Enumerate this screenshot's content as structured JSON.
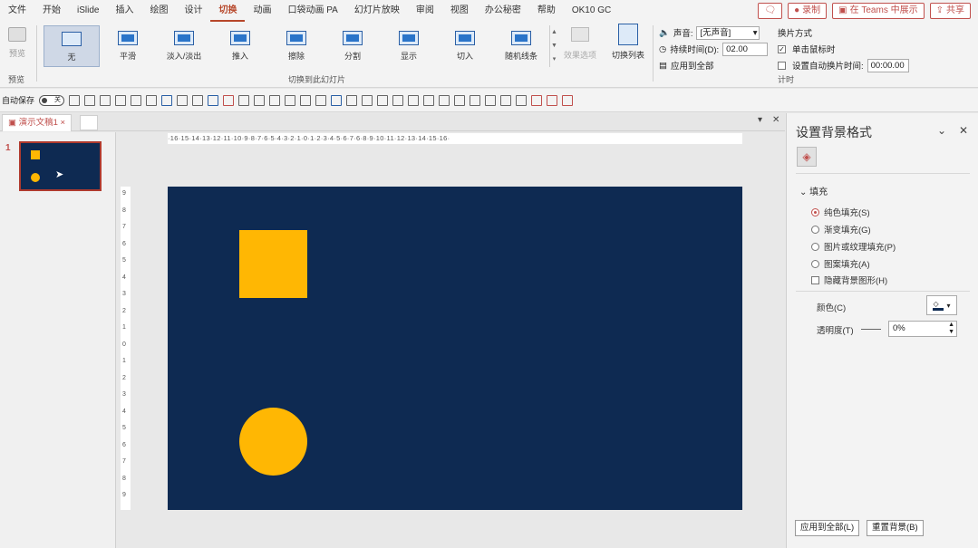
{
  "menu": {
    "tabs": [
      "文件",
      "开始",
      "iSlide",
      "插入",
      "绘图",
      "设计",
      "切换",
      "动画",
      "口袋动画 PA",
      "幻灯片放映",
      "审阅",
      "视图",
      "办公秘密",
      "帮助",
      "OK10 GC"
    ],
    "active_index": 6,
    "comment_label": "🗨",
    "record_label": "录制",
    "teams_label": "在 Teams 中展示",
    "share_label": "共享"
  },
  "ribbon": {
    "preview": {
      "label": "预览",
      "group_label": "预览"
    },
    "transitions": [
      {
        "label": "无",
        "active": true
      },
      {
        "label": "平滑"
      },
      {
        "label": "淡入/淡出"
      },
      {
        "label": "推入"
      },
      {
        "label": "擦除"
      },
      {
        "label": "分割"
      },
      {
        "label": "显示"
      },
      {
        "label": "切入"
      },
      {
        "label": "随机线条"
      }
    ],
    "transitions_group_label": "切换到此幻灯片",
    "effect_options_label": "效果选项",
    "switch_list_label": "切换列表",
    "timing": {
      "sound_label": "声音:",
      "sound_value": "[无声音]",
      "duration_label": "持续时间(D):",
      "duration_value": "02.00",
      "apply_all_label": "应用到全部",
      "advance_label": "换片方式",
      "on_click_label": "单击鼠标时",
      "after_label": "设置自动换片时间:",
      "after_value": "00:00.00",
      "group_label": "计时"
    }
  },
  "qat": {
    "autosave_label": "自动保存",
    "autosave_state": "关"
  },
  "doc": {
    "tab_title": "演示文稿1"
  },
  "slides": {
    "current_number": "1"
  },
  "ruler": {
    "h": "·16·15·14·13·12·11·10·9·8·7·6·5·4·3·2·1·0·1·2·3·4·5·6·7·6·8·9·10·11·12·13·14·15·16·",
    "v": [
      "9",
      "8",
      "7",
      "6",
      "5",
      "4",
      "3",
      "2",
      "1",
      "0",
      "1",
      "2",
      "3",
      "4",
      "5",
      "6",
      "7",
      "8",
      "9"
    ]
  },
  "pane": {
    "title": "设置背景格式",
    "section_title": "填充",
    "fill_options": [
      "纯色填充(S)",
      "渐变填充(G)",
      "图片或纹理填充(P)",
      "图案填充(A)"
    ],
    "selected_fill_index": 0,
    "hide_graphics_label": "隐藏背景图形(H)",
    "color_label": "颜色(C)",
    "transparency_label": "透明度(T)",
    "transparency_value": "0%",
    "apply_all_button": "应用到全部(L)",
    "reset_button": "重置背景(B)"
  },
  "colors": {
    "slide_background": "#0e2a52",
    "shape_fill": "#ffb703",
    "accent": "#b7472a"
  }
}
